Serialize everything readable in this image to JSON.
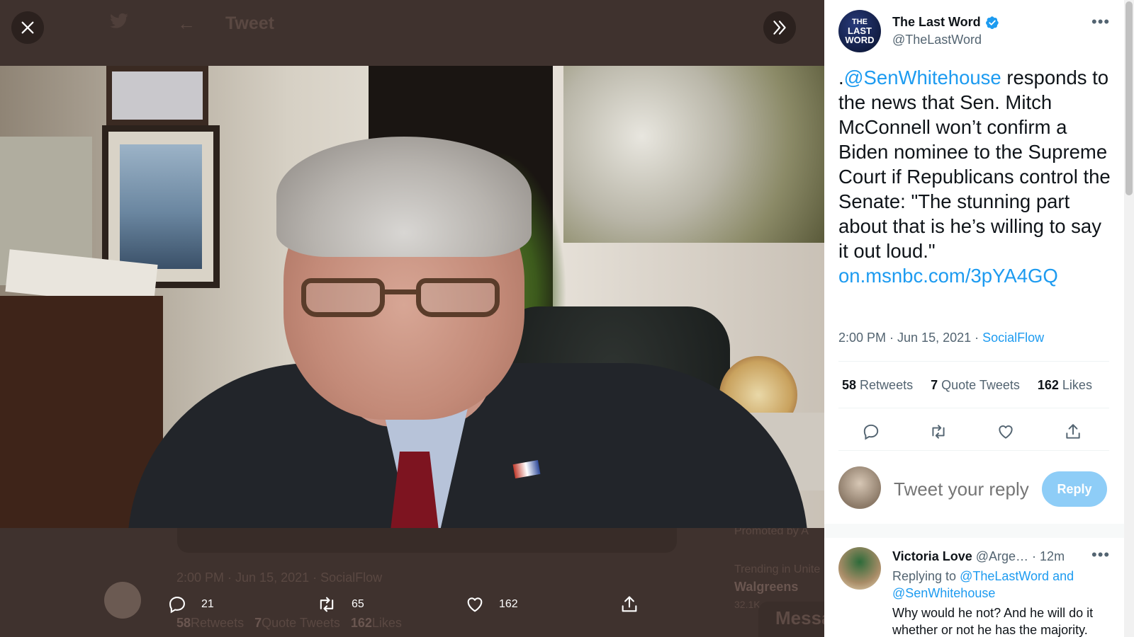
{
  "background": {
    "header_title": "Tweet",
    "timestamp": "2:00 PM · Jun 15, 2021 · SocialFlow",
    "stats": {
      "retweets": "58",
      "retweets_label": "Retweets",
      "quote": "7",
      "quote_label": "Quote Tweets",
      "likes": "162",
      "likes_label": "Likes"
    },
    "promoted": "Promoted by A",
    "trending_head": "Trending in Unite",
    "trending_name": "Walgreens",
    "trending_count": "32.1K",
    "messages": "Messa"
  },
  "media_bar": {
    "replies": "21",
    "retweets": "65",
    "likes": "162"
  },
  "tweet": {
    "author_name": "The Last Word",
    "author_handle": "@TheLastWord",
    "avatar_line1": "THE",
    "avatar_line2": "LAST WORD",
    "text_mention": "@SenWhitehouse",
    "text_prefix": ".",
    "text_body": " responds to the news that Sen. Mitch McConnell won’t confirm a Biden nominee to the Supreme Court if Republicans control the Senate: \"The stunning part about that is he’s willing to say it out loud.\" ",
    "text_link": "on.msnbc.com/3pYA4GQ",
    "time": "2:00 PM · Jun 15, 2021 · ",
    "source": "SocialFlow",
    "retweets": "58",
    "retweets_label": "Retweets",
    "quotes": "7",
    "quotes_label": "Quote Tweets",
    "likes": "162",
    "likes_label": "Likes"
  },
  "compose": {
    "placeholder": "Tweet your reply",
    "button": "Reply"
  },
  "reply": {
    "name": "Victoria Love",
    "handle": "@Arge…",
    "time": "· 12m",
    "replying_prefix": "Replying to ",
    "replying_user1": "@TheLastWord",
    "replying_and": " and ",
    "replying_user2": "@SenWhitehouse",
    "text": "Why would he not?  And he will do it whether or not he has the majority."
  },
  "colors": {
    "link": "#1d9bf0",
    "reply_button": "#8ecdf7",
    "overlay": "#3e312d"
  }
}
